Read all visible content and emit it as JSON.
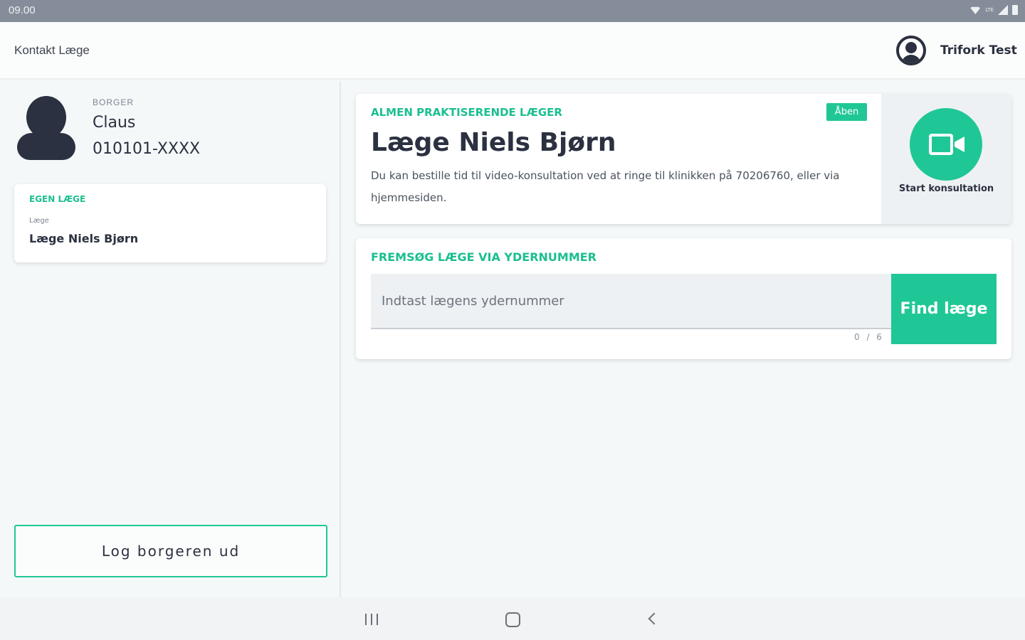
{
  "status_bar": {
    "time": "09.00",
    "network_label": "LTE",
    "icons": [
      "wifi-icon",
      "signal-icon",
      "battery-icon"
    ]
  },
  "app_bar": {
    "title": "Kontakt Læge",
    "user_name": "Trifork Test",
    "user_icon": "user-avatar-icon"
  },
  "citizen": {
    "label": "BORGER",
    "name": "Claus",
    "cpr": "010101-XXXX",
    "icon": "person-icon"
  },
  "own_doctor": {
    "heading": "EGEN LÆGE",
    "sublabel": "Læge",
    "name": "Læge Niels Bjørn"
  },
  "logout_label": "Log borgeren ud",
  "gp_card": {
    "category": "ALMEN PRAKTISERENDE LÆGER",
    "status": "Åben",
    "doctor_name": "Læge Niels Bjørn",
    "description": "Du kan bestille tid til video-konsultation ved at ringe til klinikken på 70206760, eller via hjemmesiden.",
    "start_label": "Start konsultation",
    "start_icon": "video-camera-icon"
  },
  "search": {
    "heading": "FREMSØG LÆGE VIA YDERNUMMER",
    "placeholder": "Indtast lægens ydernummer",
    "value": "",
    "counter": "0 / 6",
    "button_label": "Find læge"
  },
  "colors": {
    "accent": "#20c796",
    "accent_text": "#1bbf8f",
    "dark": "#2b3140",
    "status_bar": "#868d9a"
  },
  "nav_bar": {
    "icons": [
      "recents-icon",
      "home-icon",
      "back-icon"
    ]
  }
}
